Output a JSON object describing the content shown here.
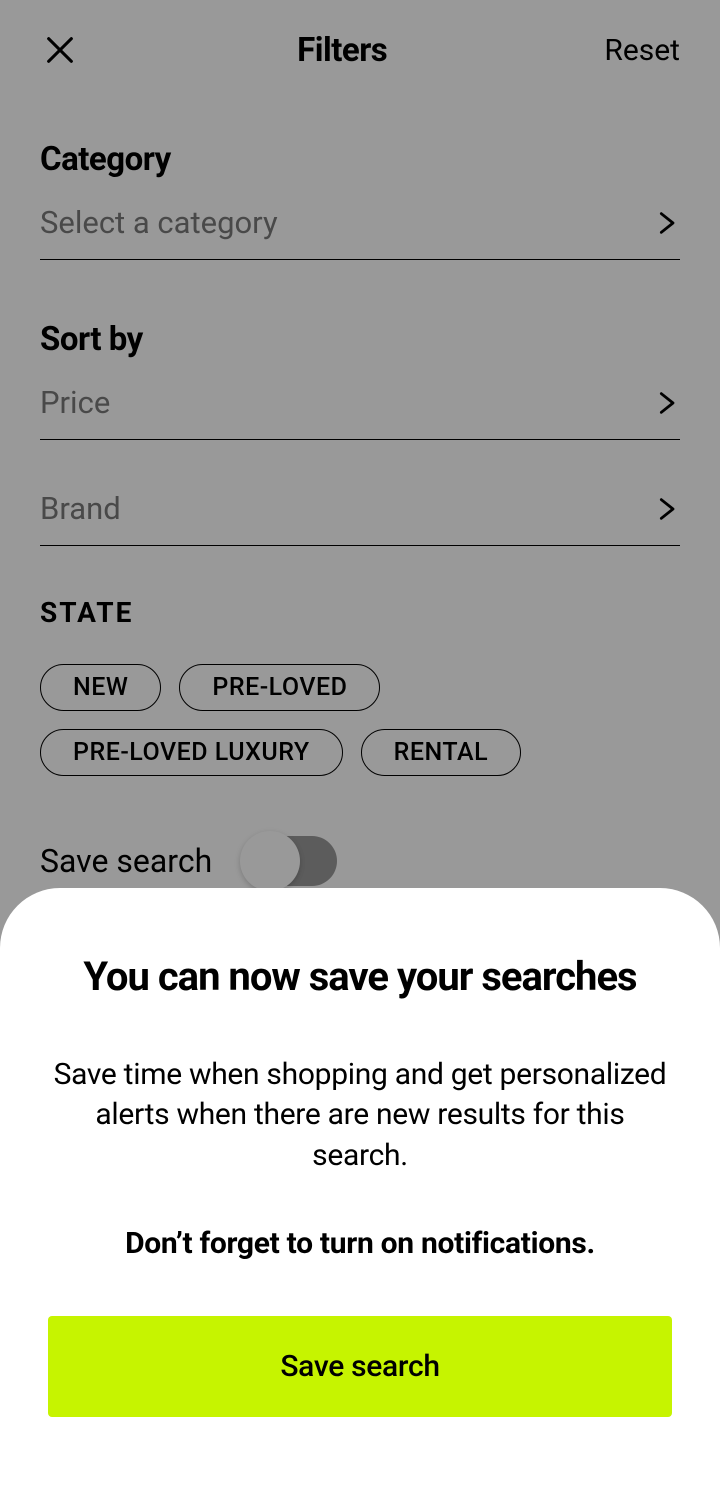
{
  "header": {
    "title": "Filters",
    "reset": "Reset"
  },
  "category": {
    "label": "Category",
    "placeholder": "Select a category"
  },
  "sort": {
    "label": "Sort by",
    "options": [
      "Price",
      "Brand"
    ]
  },
  "state": {
    "label": "STATE",
    "chips": [
      "NEW",
      "PRE-LOVED",
      "PRE-LOVED LUXURY",
      "RENTAL"
    ]
  },
  "save_search_toggle": {
    "label": "Save search",
    "value": false
  },
  "sheet": {
    "title": "You can now save your searches",
    "body": "Save time when shopping and get personalized alerts when there are new results for this search.",
    "note": "Don’t forget to turn on notifications.",
    "button": "Save search"
  },
  "colors": {
    "accent": "#c6f400",
    "overlay": "rgba(0,0,0,0.40)"
  }
}
